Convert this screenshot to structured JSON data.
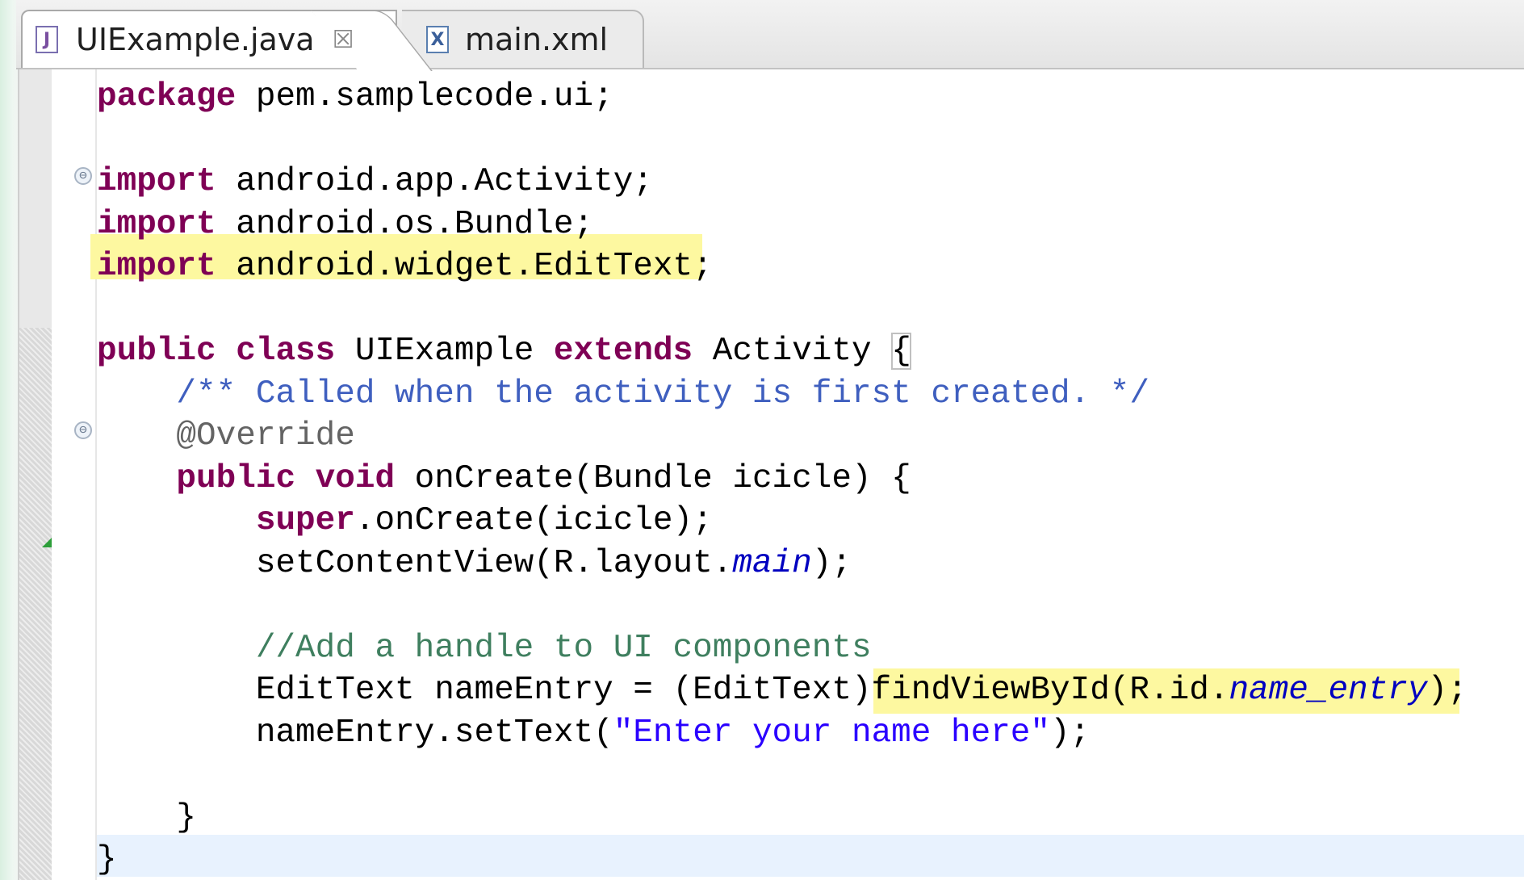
{
  "tabs": [
    {
      "label": "UIExample.java",
      "icon": "java-file-icon",
      "icon_glyph": "J",
      "active": true,
      "close_glyph": "☒"
    },
    {
      "label": "main.xml",
      "icon": "xml-file-icon",
      "icon_glyph": "X",
      "active": false
    }
  ],
  "editor": {
    "fold_glyph": "⊖",
    "lines": [
      {
        "segments": [
          {
            "t": "package",
            "c": "kw"
          },
          {
            "t": " pem.samplecode.ui;",
            "c": ""
          }
        ]
      },
      {
        "segments": []
      },
      {
        "segments": [
          {
            "t": "import",
            "c": "kw"
          },
          {
            "t": " android.app.Activity;",
            "c": ""
          }
        ]
      },
      {
        "segments": [
          {
            "t": "import",
            "c": "kw"
          },
          {
            "t": " android.os.Bundle;",
            "c": ""
          }
        ]
      },
      {
        "segments": [
          {
            "t": "import",
            "c": "kw"
          },
          {
            "t": " android.widget.EditText;",
            "c": ""
          }
        ]
      },
      {
        "segments": []
      },
      {
        "segments": [
          {
            "t": "public",
            "c": "kw"
          },
          {
            "t": " ",
            "c": ""
          },
          {
            "t": "class",
            "c": "kw"
          },
          {
            "t": " UIExample ",
            "c": ""
          },
          {
            "t": "extends",
            "c": "kw"
          },
          {
            "t": " Activity ",
            "c": ""
          },
          {
            "t": "{",
            "c": "brace-box"
          }
        ]
      },
      {
        "segments": [
          {
            "t": "    /** Called when the activity is first created. */",
            "c": "jd"
          }
        ]
      },
      {
        "segments": [
          {
            "t": "    @Override",
            "c": "an"
          }
        ]
      },
      {
        "segments": [
          {
            "t": "    ",
            "c": ""
          },
          {
            "t": "public",
            "c": "kw"
          },
          {
            "t": " ",
            "c": ""
          },
          {
            "t": "void",
            "c": "kw"
          },
          {
            "t": " onCreate(Bundle icicle) {",
            "c": ""
          }
        ]
      },
      {
        "segments": [
          {
            "t": "        ",
            "c": ""
          },
          {
            "t": "super",
            "c": "kw"
          },
          {
            "t": ".onCreate(icicle);",
            "c": ""
          }
        ]
      },
      {
        "segments": [
          {
            "t": "        setContentView(R.layout.",
            "c": ""
          },
          {
            "t": "main",
            "c": "fld"
          },
          {
            "t": ");",
            "c": ""
          }
        ]
      },
      {
        "segments": []
      },
      {
        "segments": [
          {
            "t": "        //Add a handle to UI components",
            "c": "cm"
          }
        ]
      },
      {
        "segments": [
          {
            "t": "        EditText nameEntry = (EditText)findViewById(R.id.",
            "c": ""
          },
          {
            "t": "name_entry",
            "c": "fld"
          },
          {
            "t": ");",
            "c": ""
          }
        ]
      },
      {
        "segments": [
          {
            "t": "        nameEntry.setText(",
            "c": ""
          },
          {
            "t": "\"Enter your name here\"",
            "c": "str"
          },
          {
            "t": ");",
            "c": ""
          }
        ]
      },
      {
        "segments": []
      },
      {
        "segments": [
          {
            "t": "    }",
            "c": ""
          }
        ]
      },
      {
        "segments": [
          {
            "t": "}",
            "c": ""
          }
        ]
      }
    ]
  }
}
